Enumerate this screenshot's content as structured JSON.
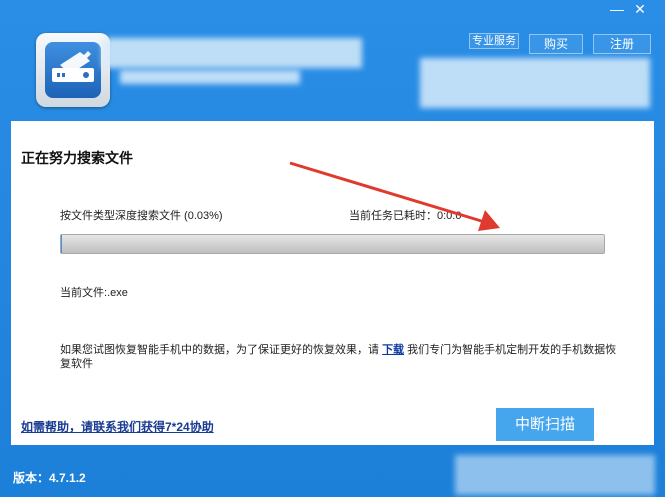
{
  "window": {
    "minimize_glyph": "—",
    "close_glyph": "✕"
  },
  "header": {
    "logo_icon": "hard-drive-wrench-icon",
    "pro_service_label": "专业服务",
    "buy_label": "购买",
    "register_label": "注册"
  },
  "scan": {
    "title": "正在努力搜索文件",
    "progress_label": "按文件类型深度搜索文件 (0.03%)",
    "progress_fraction": 0.0003,
    "elapsed_label": "当前任务已耗时：",
    "elapsed_value": "0:0:0",
    "current_file_label": "当前文件:",
    "current_file_value": ".exe"
  },
  "notice": {
    "text_before": "如果您试图恢复智能手机中的数据，为了保证更好的恢复效果，请",
    "link_label": "下载",
    "text_after": "我们专门为智能手机定制开发的手机数据恢复软件"
  },
  "help_link": "如需帮助，请联系我们获得7*24协助",
  "stop_button": "中断扫描",
  "version": "版本：4.7.1.2",
  "colors": {
    "header_blue": "#1c7fd8",
    "button_blue": "#45a6ee",
    "annotation_red": "#e03a2e"
  }
}
